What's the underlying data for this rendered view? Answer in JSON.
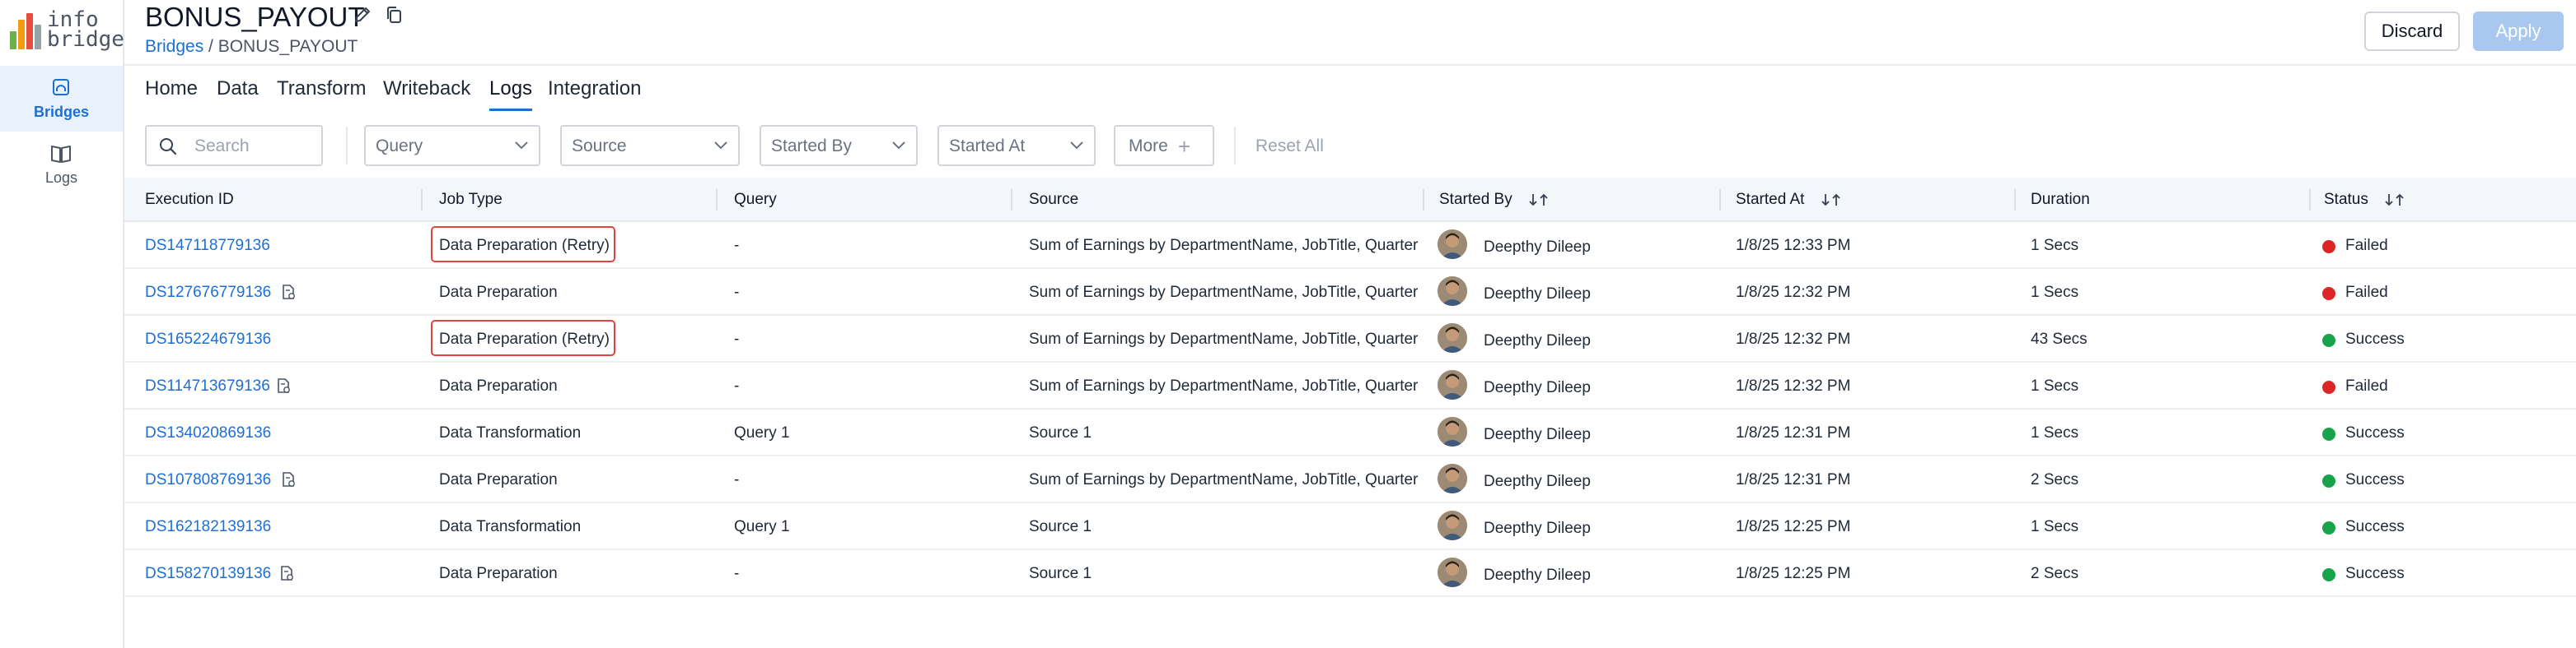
{
  "app": {
    "logo_text_top": "info",
    "logo_text_bottom": "bridge",
    "logo_bar_colors": [
      "#6ab04c",
      "#f39c12",
      "#e74c3c",
      "#95a5a6"
    ]
  },
  "sidebar": {
    "items": [
      {
        "label": "Bridges",
        "icon": "bridge-icon",
        "active": true
      },
      {
        "label": "Logs",
        "icon": "book-icon",
        "active": false
      }
    ]
  },
  "header": {
    "title": "BONUS_PAYOUT",
    "breadcrumb_link": "Bridges",
    "breadcrumb_sep": " / ",
    "breadcrumb_current": "BONUS_PAYOUT",
    "discard_label": "Discard",
    "apply_label": "Apply"
  },
  "tabs": [
    {
      "label": "Home"
    },
    {
      "label": "Data"
    },
    {
      "label": "Transform"
    },
    {
      "label": "Writeback"
    },
    {
      "label": "Logs",
      "active": true
    },
    {
      "label": "Integration"
    }
  ],
  "filters": {
    "search_placeholder": "Search",
    "query_label": "Query",
    "source_label": "Source",
    "started_by_label": "Started By",
    "started_at_label": "Started At",
    "more_label": "More",
    "reset_label": "Reset All"
  },
  "table": {
    "columns": [
      {
        "label": "Execution ID"
      },
      {
        "label": "Job Type"
      },
      {
        "label": "Query"
      },
      {
        "label": "Source"
      },
      {
        "label": "Started By",
        "sortable": true
      },
      {
        "label": "Started At",
        "sortable": true
      },
      {
        "label": "Duration"
      },
      {
        "label": "Status",
        "sortable": true
      }
    ],
    "rows": [
      {
        "id": "DS147118779136",
        "doc_icon": false,
        "job_type": "Data Preparation (Retry)",
        "highlight": true,
        "query": "-",
        "source": "Sum of Earnings by DepartmentName, JobTitle, Quarter",
        "started_by": "Deepthy Dileep",
        "started_at": "1/8/25 12:33 PM",
        "duration": "1 Secs",
        "status": "Failed"
      },
      {
        "id": "DS127676779136",
        "doc_icon": true,
        "job_type": "Data Preparation",
        "highlight": false,
        "query": "-",
        "source": "Sum of Earnings by DepartmentName, JobTitle, Quarter",
        "started_by": "Deepthy Dileep",
        "started_at": "1/8/25 12:32 PM",
        "duration": "1 Secs",
        "status": "Failed"
      },
      {
        "id": "DS165224679136",
        "doc_icon": false,
        "job_type": "Data Preparation (Retry)",
        "highlight": true,
        "query": "-",
        "source": "Sum of Earnings by DepartmentName, JobTitle, Quarter",
        "started_by": "Deepthy Dileep",
        "started_at": "1/8/25 12:32 PM",
        "duration": "43 Secs",
        "status": "Success"
      },
      {
        "id": "DS114713679136",
        "doc_icon": true,
        "job_type": "Data Preparation",
        "highlight": false,
        "query": "-",
        "source": "Sum of Earnings by DepartmentName, JobTitle, Quarter",
        "started_by": "Deepthy Dileep",
        "started_at": "1/8/25 12:32 PM",
        "duration": "1 Secs",
        "status": "Failed"
      },
      {
        "id": "DS134020869136",
        "doc_icon": false,
        "job_type": "Data Transformation",
        "highlight": false,
        "query": "Query 1",
        "source": "Source 1",
        "started_by": "Deepthy Dileep",
        "started_at": "1/8/25 12:31 PM",
        "duration": "1 Secs",
        "status": "Success"
      },
      {
        "id": "DS107808769136",
        "doc_icon": true,
        "job_type": "Data Preparation",
        "highlight": false,
        "query": "-",
        "source": "Sum of Earnings by DepartmentName, JobTitle, Quarter",
        "started_by": "Deepthy Dileep",
        "started_at": "1/8/25 12:31 PM",
        "duration": "2 Secs",
        "status": "Success"
      },
      {
        "id": "DS162182139136",
        "doc_icon": false,
        "job_type": "Data Transformation",
        "highlight": false,
        "query": "Query 1",
        "source": "Source 1",
        "started_by": "Deepthy Dileep",
        "started_at": "1/8/25 12:25 PM",
        "duration": "1 Secs",
        "status": "Success"
      },
      {
        "id": "DS158270139136",
        "doc_icon": true,
        "job_type": "Data Preparation",
        "highlight": false,
        "query": "-",
        "source": "Source 1",
        "started_by": "Deepthy Dileep",
        "started_at": "1/8/25 12:25 PM",
        "duration": "2 Secs",
        "status": "Success"
      }
    ],
    "status_colors": {
      "Failed": "#dc2626",
      "Success": "#16a34a"
    }
  }
}
